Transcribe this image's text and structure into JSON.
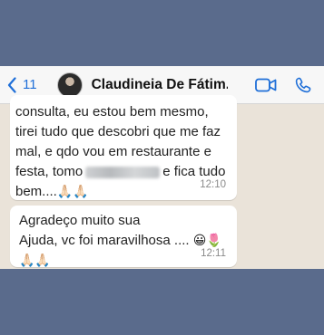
{
  "header": {
    "back_count": "11",
    "contact_name": "Claudineia De Fátim..."
  },
  "messages": [
    {
      "lines": [
        "consulta, eu estou bem mesmo,",
        "tirei tudo que descobri que me faz",
        "mal, e qdo vou em restaurante e",
        "festa, tomo",
        "e fica tudo",
        "bem....",
        "🙏🏻🙏🏻"
      ],
      "time": "12:10"
    },
    {
      "lines": [
        "Agradeço muito sua",
        "Ajuda, vc foi maravilhosa ....",
        "😀🌷",
        "🙏🏻🙏🏻"
      ],
      "time": "12:11"
    }
  ],
  "colors": {
    "accent": "#1f6fd8",
    "frame": "#5a6b8c",
    "chat_bg": "#eae3d9",
    "bubble": "#ffffff"
  },
  "icons": [
    "chevron-left-icon",
    "video-call-icon",
    "phone-icon",
    "pray-emoji",
    "grin-emoji",
    "tulip-emoji"
  ]
}
